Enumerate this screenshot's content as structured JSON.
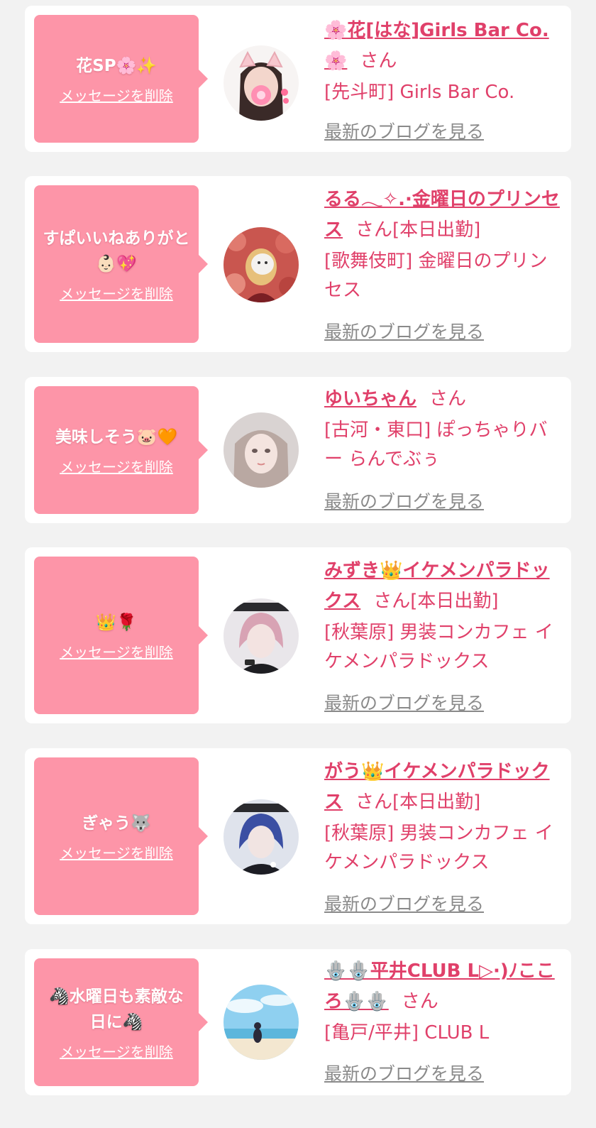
{
  "colors": {
    "background": "#f2f2f2",
    "card": "#ffffff",
    "bubble": "#fd95a8",
    "accent_text": "#e0406a",
    "blog_link": "#8a8a8a"
  },
  "delete_label": "メッセージを削除",
  "blog_label": "最新のブログを見る",
  "san_label": "さん",
  "entries": [
    {
      "message": "花SP🌸✨",
      "name": "🌸花[はな]Girls Bar Co. 🌸",
      "attendance": "",
      "shop": "[先斗町] Girls Bar Co.",
      "avatar_icon": "cat-filter-girl-avatar"
    },
    {
      "message": "すぱいいねありがと👶🏻💖",
      "name": "るる𓂃✧.·金曜日のプリンセス",
      "attendance": "[本日出勤]",
      "shop": "[歌舞伎町] 金曜日のプリンセス",
      "avatar_icon": "flower-background-avatar"
    },
    {
      "message": "美味しそう🐷🧡",
      "name": "ゆいちゃん",
      "attendance": "",
      "shop": "[古河・東口] ぽっちゃりバー らんでぶぅ",
      "avatar_icon": "girl-portrait-avatar"
    },
    {
      "message": "👑🌹",
      "name": "みずき👑イケメンパラドックス",
      "attendance": "[本日出勤]",
      "shop": "[秋葉原] 男装コンカフェ イケメンパラドックス",
      "avatar_icon": "pink-hair-host-avatar"
    },
    {
      "message": "ぎゃう🐺",
      "name": "がう👑イケメンパラドックス",
      "attendance": "[本日出勤]",
      "shop": "[秋葉原] 男装コンカフェ イケメンパラドックス",
      "avatar_icon": "blue-hair-host-avatar"
    },
    {
      "message": "🦓水曜日も素敵な日に🦓",
      "name": "🪬🪬平井CLUB L▷·)ﾉこころ🪬🪬",
      "attendance": "",
      "shop": "[亀戸/平井] CLUB L",
      "avatar_icon": "beach-avatar"
    }
  ]
}
